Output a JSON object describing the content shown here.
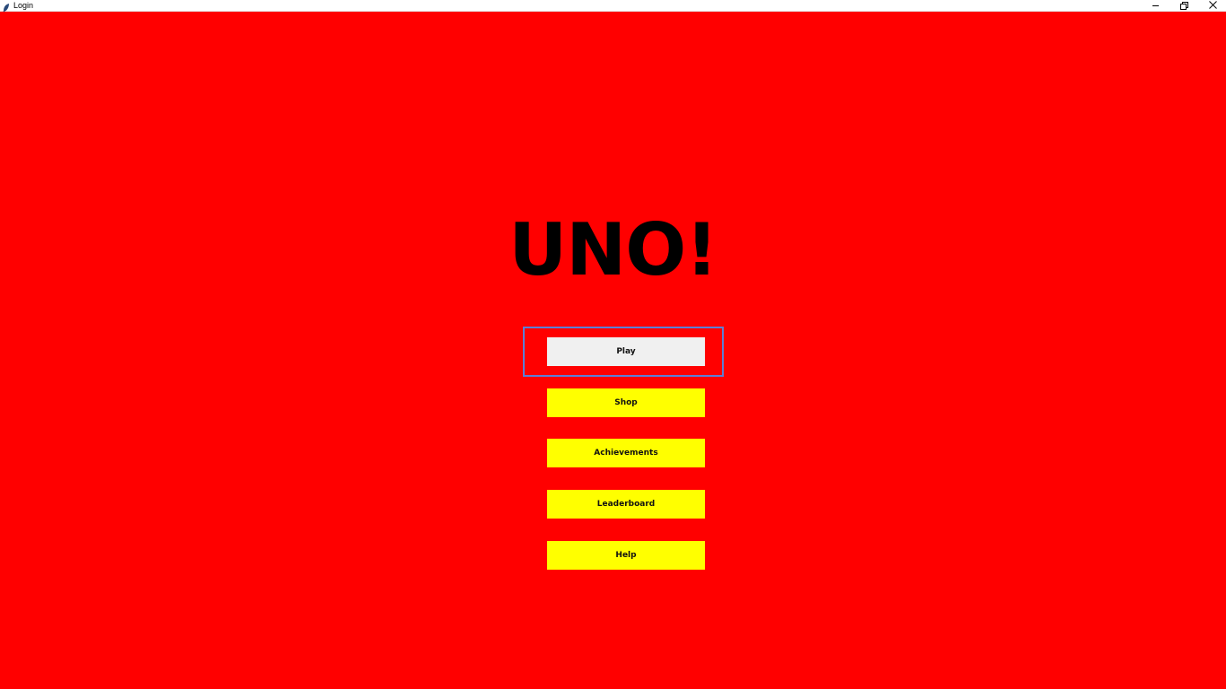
{
  "window": {
    "title": "Login",
    "icon": "feather-icon",
    "controls": [
      "minimize-icon",
      "restore-icon",
      "close-icon"
    ]
  },
  "main": {
    "title": "UNO!",
    "background_color": "#ff0000",
    "buttons": [
      {
        "label": "Play",
        "color": "#f0f0f0",
        "focused": true
      },
      {
        "label": "Shop",
        "color": "#ffff00"
      },
      {
        "label": "Achievements",
        "color": "#ffff00"
      },
      {
        "label": "Leaderboard",
        "color": "#ffff00"
      },
      {
        "label": "Help",
        "color": "#ffff00"
      }
    ]
  }
}
